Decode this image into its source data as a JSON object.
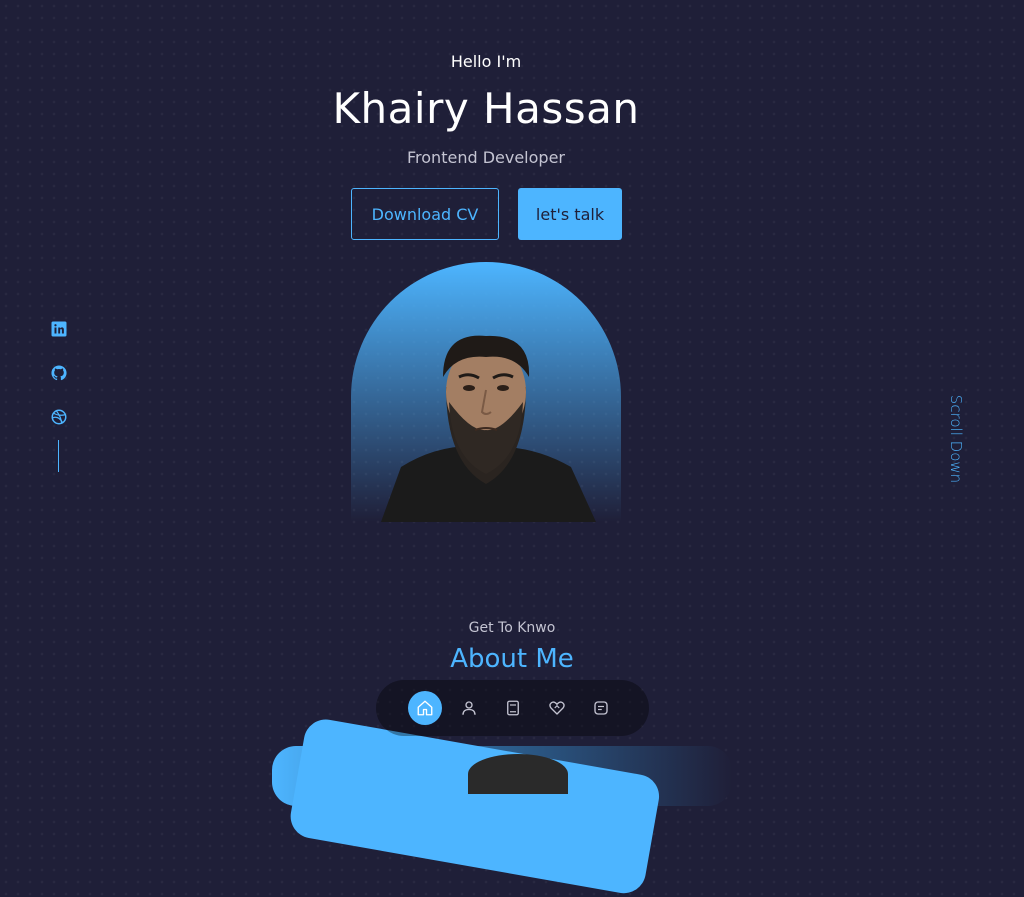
{
  "hero": {
    "greeting": "Hello I'm",
    "name": "Khairy Hassan",
    "role": "Frontend Developer",
    "download_label": "Download CV",
    "talk_label": "let's talk"
  },
  "socials": [
    "linkedin-icon",
    "github-icon",
    "dribbble-icon"
  ],
  "scroll_label": "Scroll Down",
  "about": {
    "subtitle": "Get To Knwo",
    "title": "About Me"
  },
  "nav": {
    "items": [
      "home-icon",
      "user-icon",
      "book-icon",
      "services-icon",
      "message-icon"
    ],
    "active": "home-icon"
  },
  "colors": {
    "background": "#1f1f38",
    "accent": "#4db5ff",
    "text": "#ffffff",
    "muted": "#c4c4d2"
  }
}
